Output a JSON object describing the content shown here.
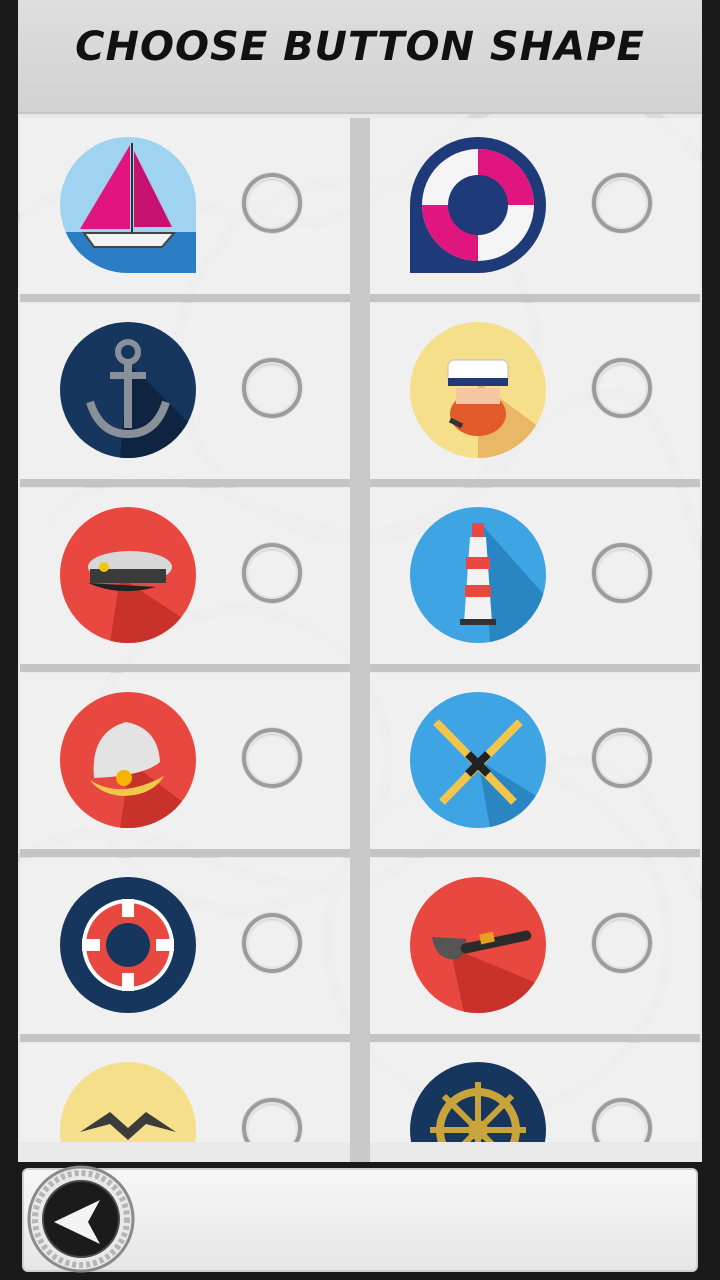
{
  "header": {
    "title": "CHOOSE BUTTON SHAPE"
  },
  "options": [
    {
      "icon": "sailboat-icon",
      "selected": false
    },
    {
      "icon": "lifebuoy-icon",
      "selected": false
    },
    {
      "icon": "anchor-icon",
      "selected": false
    },
    {
      "icon": "sailor-captain-icon",
      "selected": false
    },
    {
      "icon": "captain-hat-icon",
      "selected": false
    },
    {
      "icon": "lighthouse-icon",
      "selected": false
    },
    {
      "icon": "pearl-shell-icon",
      "selected": false
    },
    {
      "icon": "crossed-oars-icon",
      "selected": false
    },
    {
      "icon": "life-ring-icon",
      "selected": false
    },
    {
      "icon": "smoking-pipe-icon",
      "selected": false
    },
    {
      "icon": "seagull-icon",
      "selected": false
    },
    {
      "icon": "ship-wheel-icon",
      "selected": false
    }
  ],
  "footer": {
    "back_icon": "back-arrow-icon"
  }
}
